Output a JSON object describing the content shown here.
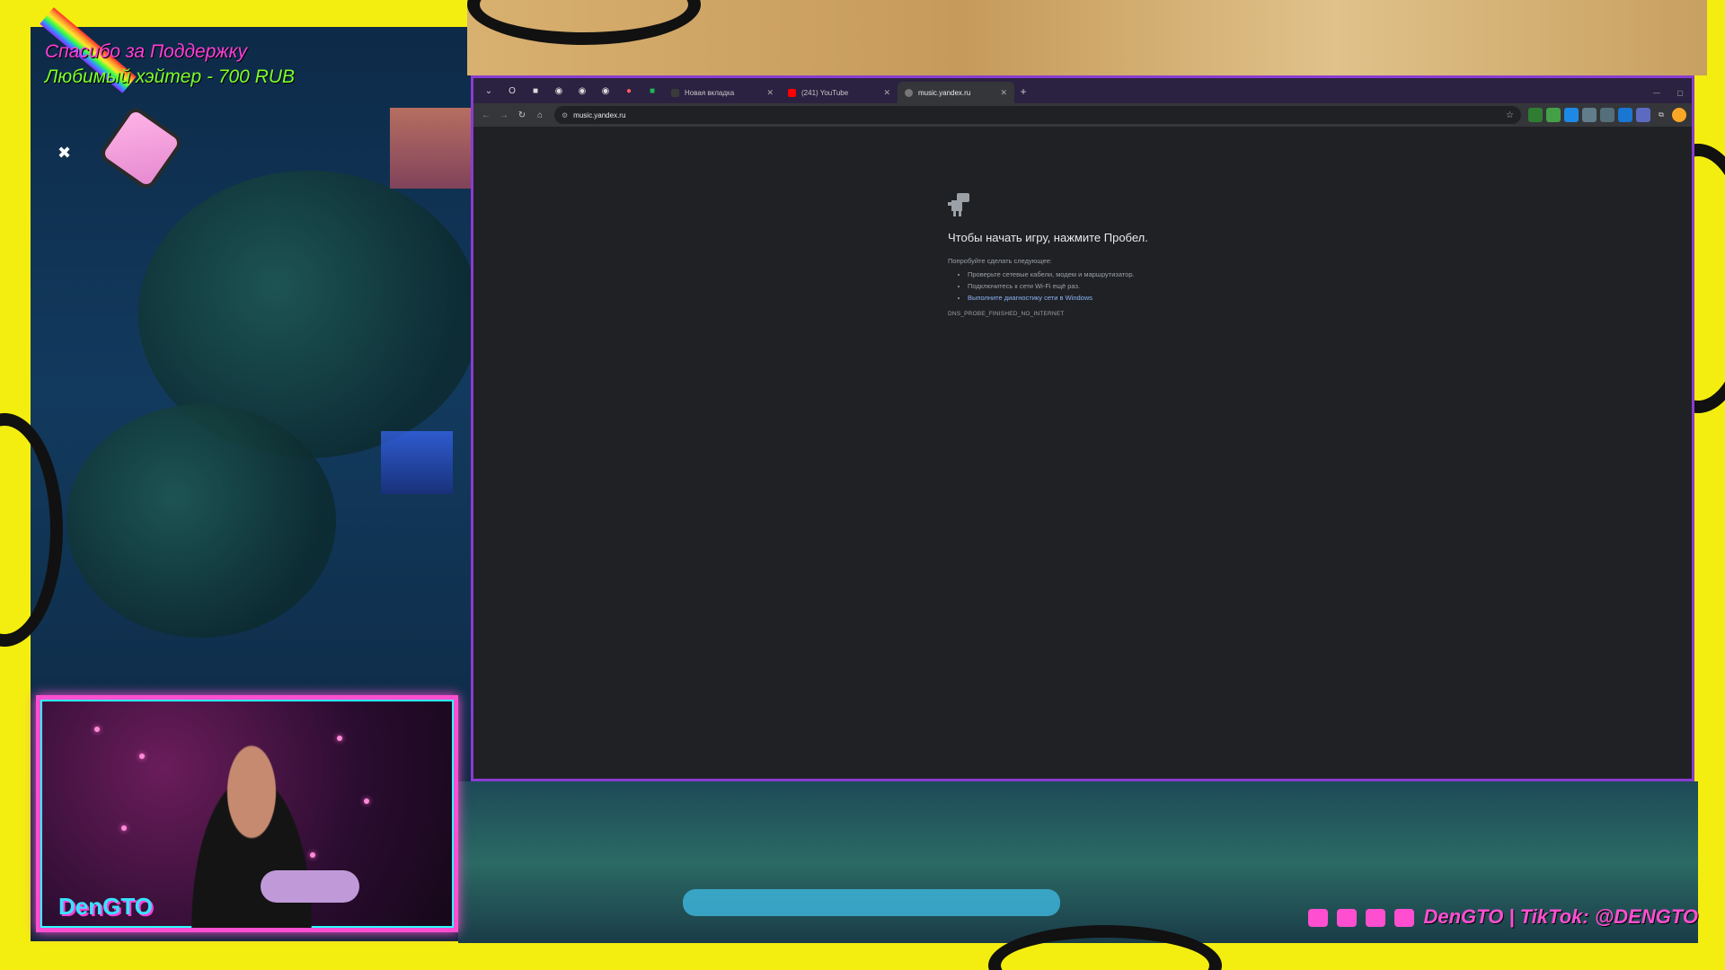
{
  "overlay": {
    "donation_title": "Спасибо за Поддержку",
    "donation_line": "Любимый хэйтер - 700 RUB",
    "channel_logo": "DenGTO",
    "socials": "DenGTO | TikTok: @DENGTO",
    "social_icons": [
      "twitch-icon",
      "youtube-icon",
      "discord-icon",
      "vk-icon"
    ],
    "colors": {
      "frame_yellow": "#f3ee10",
      "neon_pink": "#ff4fd0",
      "neon_green": "#7dff2a",
      "browser_border": "#8a3bd1"
    }
  },
  "browser": {
    "tabs": [
      {
        "title": "Новая вкладка",
        "active": false,
        "favicon_color": "#3a3a3a"
      },
      {
        "title": "(241) YouTube",
        "active": false,
        "favicon_color": "#ff0000"
      },
      {
        "title": "music.yandex.ru",
        "active": true,
        "favicon_color": "#777777"
      }
    ],
    "url": "music.yandex.ru",
    "error": {
      "title": "Чтобы начать игру, нажмите Пробел.",
      "try_label": "Попробуйте сделать следующее:",
      "suggestions": [
        "Проверьте сетевые кабели, модем и маршрутизатор.",
        "Подключитесь к сети Wi-Fi ещё раз."
      ],
      "diagnostics_link": "Выполните диагностику сети в Windows",
      "code": "DNS_PROBE_FINISHED_NO_INTERNET"
    }
  }
}
